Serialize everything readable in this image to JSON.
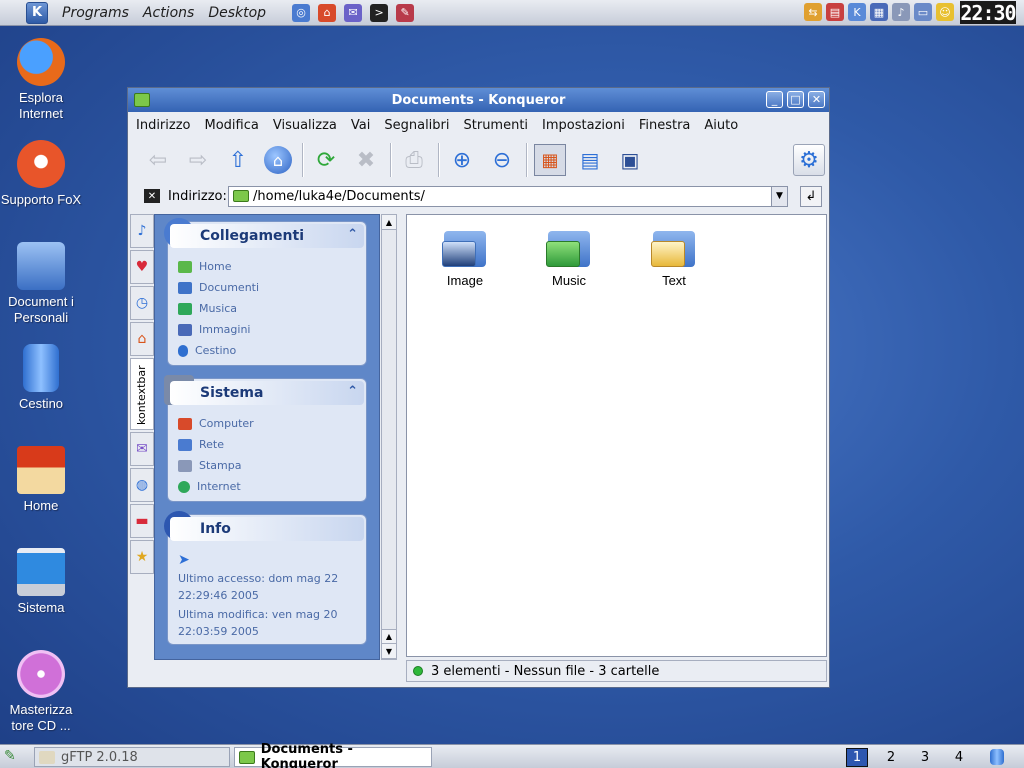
{
  "top_panel": {
    "menus": [
      "Programs",
      "Actions",
      "Desktop"
    ],
    "clock": "22:30"
  },
  "desktop_icons": [
    {
      "label": "Esplora Internet",
      "icon": "firefox-icon"
    },
    {
      "label": "Supporto FoX",
      "icon": "fox-icon"
    },
    {
      "label": "Document i Personali",
      "icon": "documents-icon"
    },
    {
      "label": "Cestino",
      "icon": "trash-icon"
    },
    {
      "label": "Home",
      "icon": "home-icon"
    },
    {
      "label": "Sistema",
      "icon": "computer-icon"
    },
    {
      "label": "Masterizza tore CD ...",
      "icon": "cd-burner-icon"
    }
  ],
  "window": {
    "title": "Documents - Konqueror",
    "menu": [
      "Indirizzo",
      "Modifica",
      "Visualizza",
      "Vai",
      "Segnalibri",
      "Strumenti",
      "Impostazioni",
      "Finestra",
      "Aiuto"
    ],
    "location_label": "Indirizzo:",
    "location_value": "/home/luka4e/Documents/",
    "sidebar_tab_label": "kontextbar",
    "sections": {
      "links": {
        "title": "Collegamenti",
        "items": [
          "Home",
          "Documenti",
          "Musica",
          "Immagini",
          "Cestino"
        ]
      },
      "system": {
        "title": "Sistema",
        "items": [
          "Computer",
          "Rete",
          "Stampa",
          "Internet"
        ]
      },
      "info": {
        "title": "Info",
        "last_access": "Ultimo accesso: dom mag 22 22:29:46 2005",
        "last_modified": "Ultima modifica: ven mag 20 22:03:59 2005"
      }
    },
    "files": [
      {
        "name": "Image",
        "icon": "image-folder-icon"
      },
      {
        "name": "Music",
        "icon": "music-folder-icon"
      },
      {
        "name": "Text",
        "icon": "text-folder-icon"
      }
    ],
    "status": "3 elementi - Nessun file - 3 cartelle"
  },
  "taskbar": {
    "tasks": [
      "gFTP 2.0.18",
      "Documents - Konqueror"
    ],
    "desktops": [
      "1",
      "2",
      "3",
      "4"
    ],
    "active_desktop": "1"
  },
  "colors": {
    "desktop_bg": "#2f5aa8",
    "titlebar": "#3463b3",
    "sidebar_bg": "#5f87c8"
  }
}
